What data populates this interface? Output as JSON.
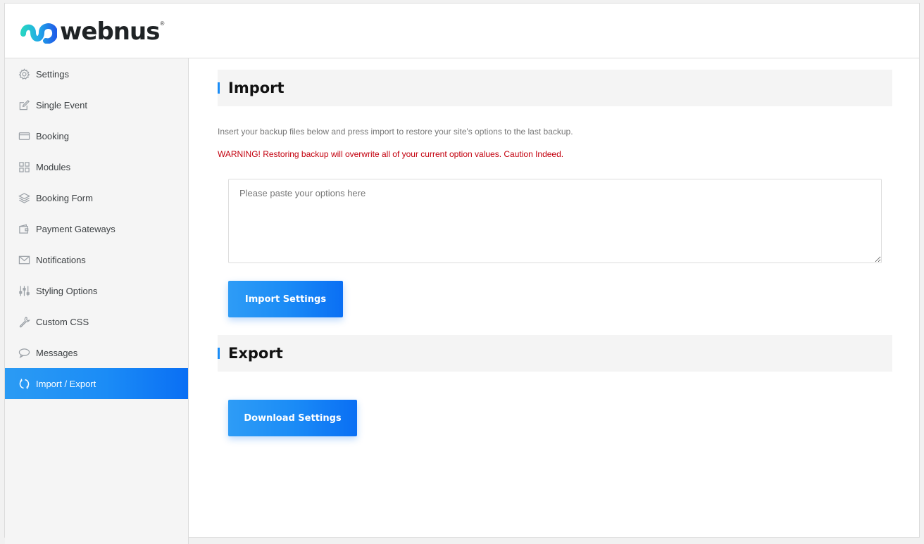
{
  "brand": {
    "logo_text": "webnus",
    "registered_mark": "®",
    "colors": {
      "accent": "#1a8cf6",
      "warning": "#c3000e"
    }
  },
  "sidebar": {
    "items": [
      {
        "label": "Settings",
        "icon": "gear-icon"
      },
      {
        "label": "Single Event",
        "icon": "edit-icon"
      },
      {
        "label": "Booking",
        "icon": "card-icon"
      },
      {
        "label": "Modules",
        "icon": "grid-icon"
      },
      {
        "label": "Booking Form",
        "icon": "layers-icon"
      },
      {
        "label": "Payment Gateways",
        "icon": "wallet-icon"
      },
      {
        "label": "Notifications",
        "icon": "envelope-icon"
      },
      {
        "label": "Styling Options",
        "icon": "sliders-icon"
      },
      {
        "label": "Custom CSS",
        "icon": "wrench-icon"
      },
      {
        "label": "Messages",
        "icon": "chat-bubble-icon"
      },
      {
        "label": "Import / Export",
        "icon": "sync-icon",
        "active": true
      }
    ]
  },
  "import": {
    "title": "Import",
    "description": "Insert your backup files below and press import to restore your site's options to the last backup.",
    "warning": "WARNING! Restoring backup will overwrite all of your current option values. Caution Indeed.",
    "textarea_placeholder": "Please paste your options here",
    "textarea_value": "",
    "button_label": "Import Settings"
  },
  "export": {
    "title": "Export",
    "button_label": "Download Settings"
  }
}
